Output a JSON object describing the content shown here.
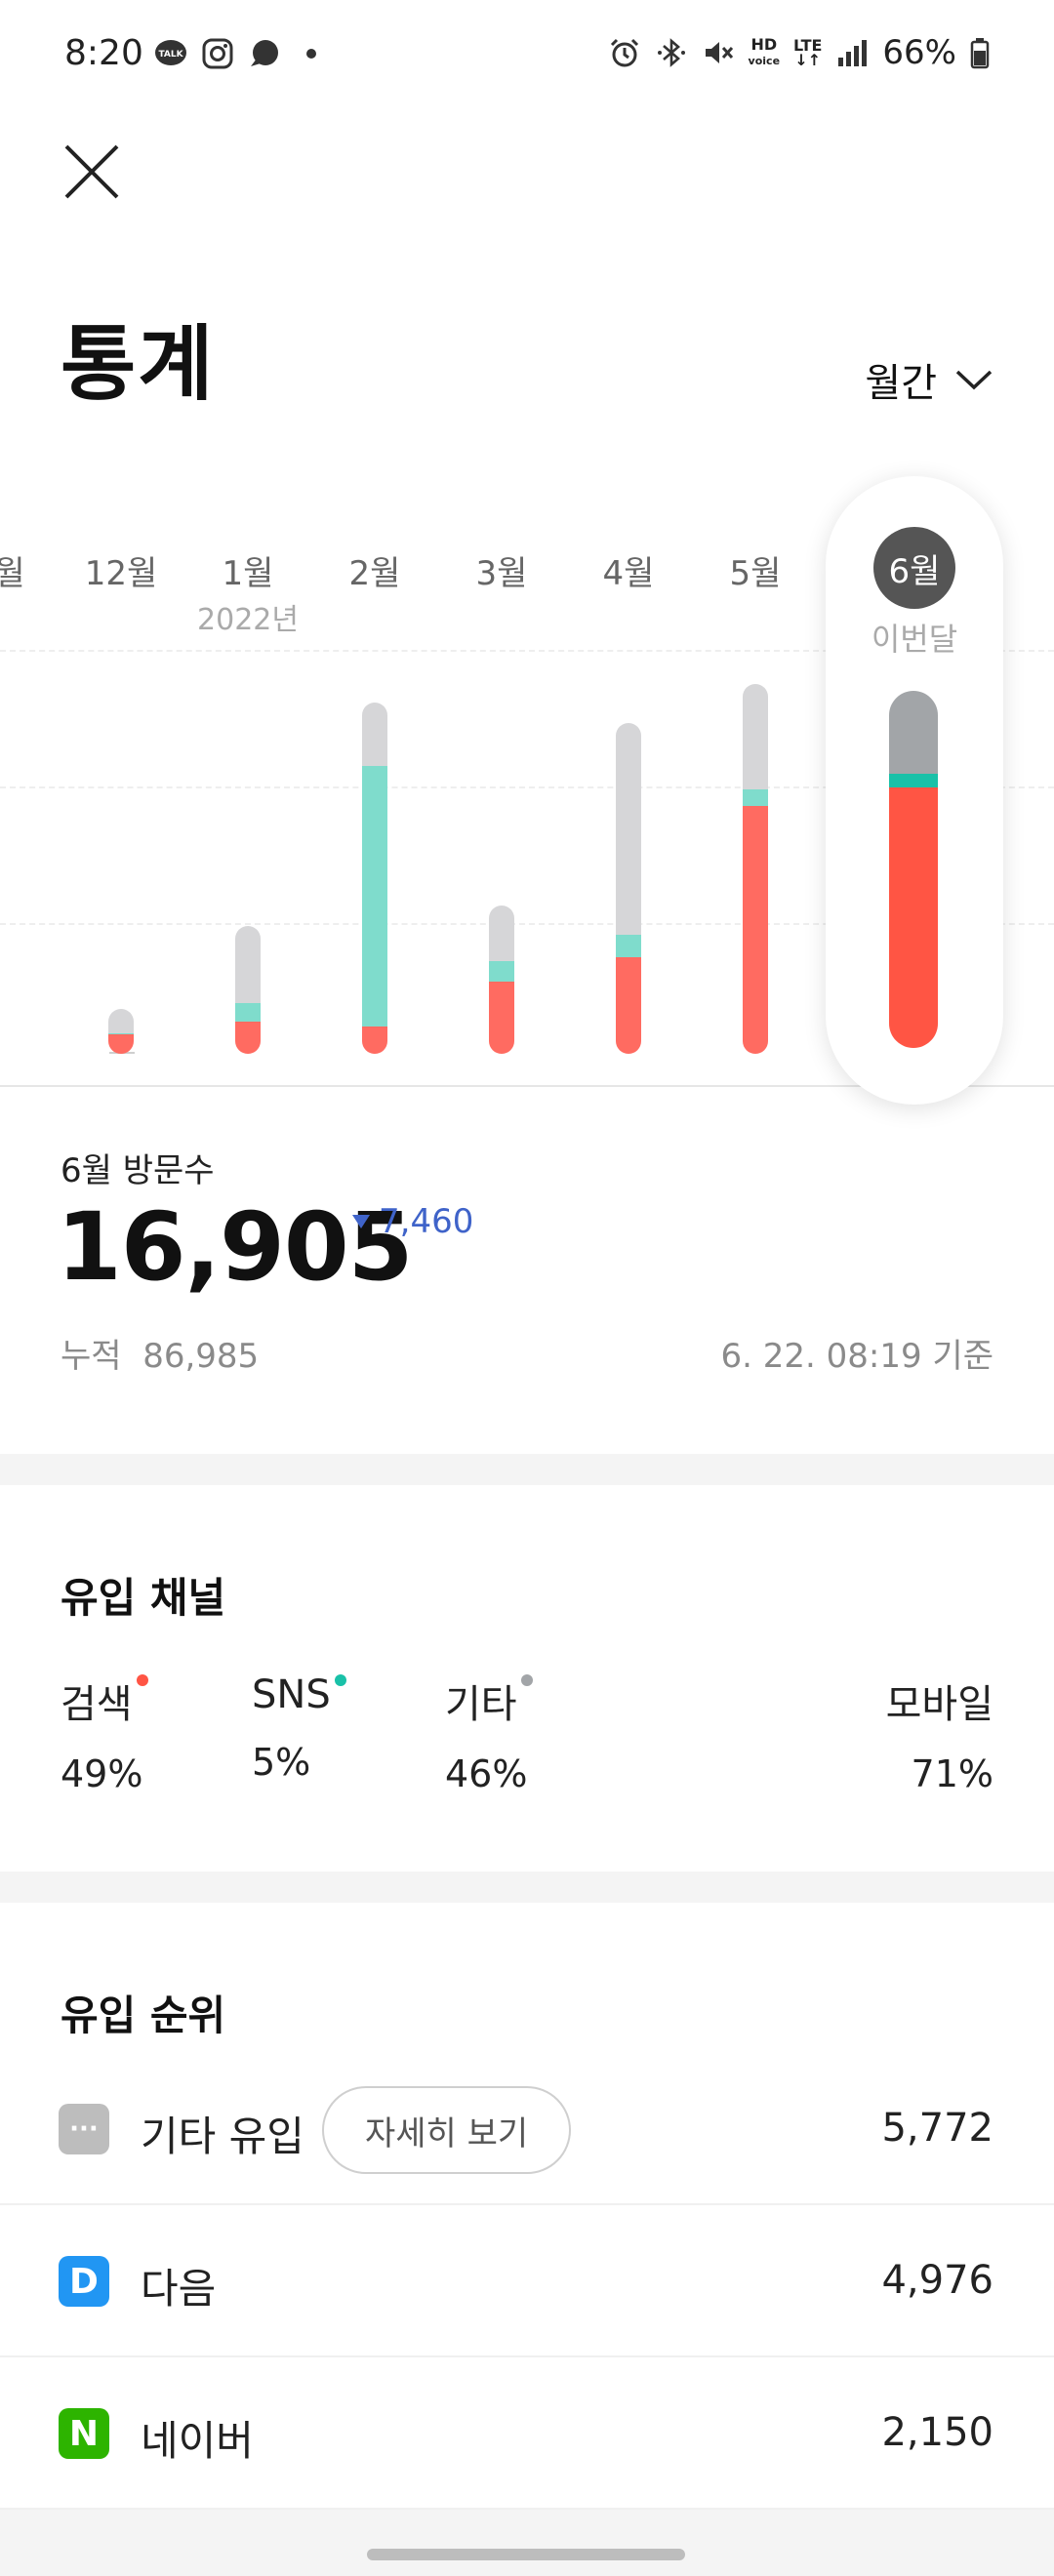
{
  "status_bar": {
    "time": "8:20",
    "talk_badge": "TALK",
    "hd_top": "HD",
    "hd_bottom": "voice",
    "lte": "LTE",
    "battery": "66%"
  },
  "header": {
    "title": "통계",
    "period": "월간"
  },
  "chart_data": {
    "type": "bar",
    "stacked": true,
    "categories": [
      "월",
      "12월",
      "1월",
      "2월",
      "3월",
      "4월",
      "5월",
      "6월"
    ],
    "year_marker": {
      "category": "1월",
      "label": "2022년"
    },
    "current": {
      "category": "6월",
      "label": "이번달"
    },
    "series": [
      {
        "key": "search",
        "color": "#ff6b61",
        "values": [
          0,
          900,
          1500,
          1300,
          3400,
          4580,
          11700,
          12300
        ]
      },
      {
        "key": "sns",
        "color": "#7fdccc",
        "values": [
          0,
          80,
          900,
          12300,
          1000,
          1050,
          790,
          680
        ]
      },
      {
        "key": "other",
        "color": "#d6d6d8",
        "values": [
          0,
          1140,
          3660,
          3000,
          2600,
          10000,
          5000,
          3925
        ]
      }
    ],
    "current_colors": {
      "search": "#ff5544",
      "sns": "#19c1a8",
      "other": "#a2a5a8"
    },
    "ylim": [
      0,
      24000
    ],
    "grid": true
  },
  "visits": {
    "caption": "6월 방문수",
    "total": "16,905",
    "delta": "7,460",
    "cumulative_label": "누적",
    "cumulative_value": "86,985",
    "as_of": "6. 22. 08:19 기준"
  },
  "channels": {
    "title": "유입 채널",
    "items": [
      {
        "name": "검색",
        "value": "49%",
        "dot_color": "#ff5544"
      },
      {
        "name": "SNS",
        "value": "5%",
        "dot_color": "#19c1a8"
      },
      {
        "name": "기타",
        "value": "46%",
        "dot_color": "#a2a5a8"
      }
    ],
    "mobile": {
      "name": "모바일",
      "value": "71%"
    }
  },
  "ranking": {
    "title": "유입 순위",
    "detail_button": "자세히 보기",
    "items": [
      {
        "name": "기타 유입",
        "value": "5,772",
        "icon": "more-dots-icon",
        "icon_char": "···",
        "color": "#bdbdbd"
      },
      {
        "name": "다음",
        "value": "4,976",
        "icon": "daum-icon",
        "icon_char": "D",
        "color": "#2196f3"
      },
      {
        "name": "네이버",
        "value": "2,150",
        "icon": "naver-icon",
        "icon_char": "N",
        "color": "#2db400"
      }
    ]
  }
}
